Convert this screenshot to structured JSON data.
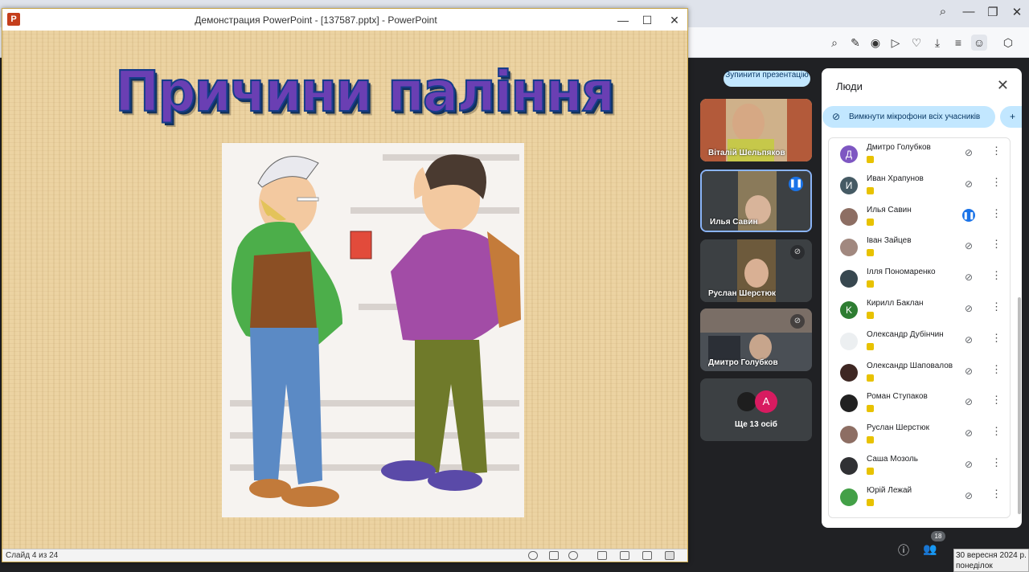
{
  "ppt": {
    "window_title": "Демонстрация PowerPoint - [137587.pptx] - PowerPoint",
    "slide_title": "Причини паління",
    "status_text": "Слайд 4 из 24"
  },
  "meet": {
    "stop_presenting": "Зупинити презентацію",
    "tiles": [
      {
        "name": "Віталій Шельпяков"
      },
      {
        "name": "Илья Савин"
      },
      {
        "name": "Руслан Шерстюк"
      },
      {
        "name": "Дмитро Голубков"
      }
    ],
    "more_tile": {
      "avatar_letter": "A",
      "label": "Ще 13 осіб"
    },
    "people_panel": {
      "title": "Люди",
      "mute_all": "Вимкнути мікрофони всіх учасників",
      "participants": [
        {
          "name": "Дмитро Голубков",
          "initial": "Д",
          "color": "#7e57c2",
          "speaking": false
        },
        {
          "name": "Иван Храпунов",
          "initial": "И",
          "color": "#455a64",
          "speaking": false
        },
        {
          "name": "Илья Савин",
          "initial": "",
          "color": "#8d6e63",
          "speaking": true
        },
        {
          "name": "Іван Зайцев",
          "initial": "",
          "color": "#a1887f",
          "speaking": false
        },
        {
          "name": "Ілля Пономаренко",
          "initial": "",
          "color": "#37474f",
          "speaking": false
        },
        {
          "name": "Кирилл Баклан",
          "initial": "K",
          "color": "#2e7d32",
          "speaking": false
        },
        {
          "name": "Олександр Дубінчин",
          "initial": "",
          "color": "#eceff1",
          "speaking": false
        },
        {
          "name": "Олександр Шаповалов",
          "initial": "",
          "color": "#3e2723",
          "speaking": false
        },
        {
          "name": "Роман Ступаков",
          "initial": "",
          "color": "#212121",
          "speaking": false
        },
        {
          "name": "Руслан Шерстюк",
          "initial": "",
          "color": "#8d6e63",
          "speaking": false
        },
        {
          "name": "Саша Мозоль",
          "initial": "",
          "color": "#303134",
          "speaking": false
        },
        {
          "name": "Юрій Лежай",
          "initial": "",
          "color": "#43a047",
          "speaking": false
        }
      ]
    },
    "participants_count": "18"
  },
  "taskbar": {
    "date": "30 вересня 2024 р.",
    "weekday": "понеділок"
  },
  "icons": [
    "search-icon",
    "minimize-icon",
    "restore-icon",
    "close-icon",
    "mic-off-icon",
    "more-vert-icon",
    "info-icon",
    "people-icon",
    "chat-icon"
  ]
}
